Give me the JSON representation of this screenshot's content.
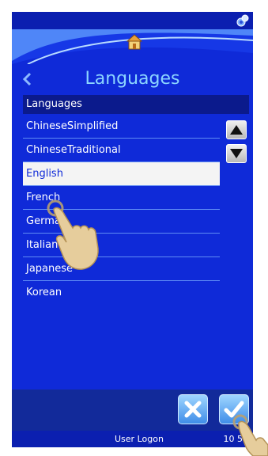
{
  "header": {
    "title": "Languages",
    "icons": {
      "app": "app-icon",
      "home": "home-icon",
      "back": "chevron-left-icon"
    }
  },
  "list": {
    "header": "Languages",
    "items": [
      {
        "label": "ChineseSimplified"
      },
      {
        "label": "ChineseTraditional"
      },
      {
        "label": "English",
        "selected": true
      },
      {
        "label": "French"
      },
      {
        "label": "German"
      },
      {
        "label": "Italian"
      },
      {
        "label": "Japanese"
      },
      {
        "label": "Korean"
      }
    ]
  },
  "actions": {
    "cancel_icon": "close-icon",
    "ok_icon": "checkmark-icon"
  },
  "status": {
    "user": "User Logon",
    "time": "10 56"
  },
  "colors": {
    "background": "#0f2ad8",
    "title": "#8cd6ff",
    "selected": "#f4f4f4"
  }
}
